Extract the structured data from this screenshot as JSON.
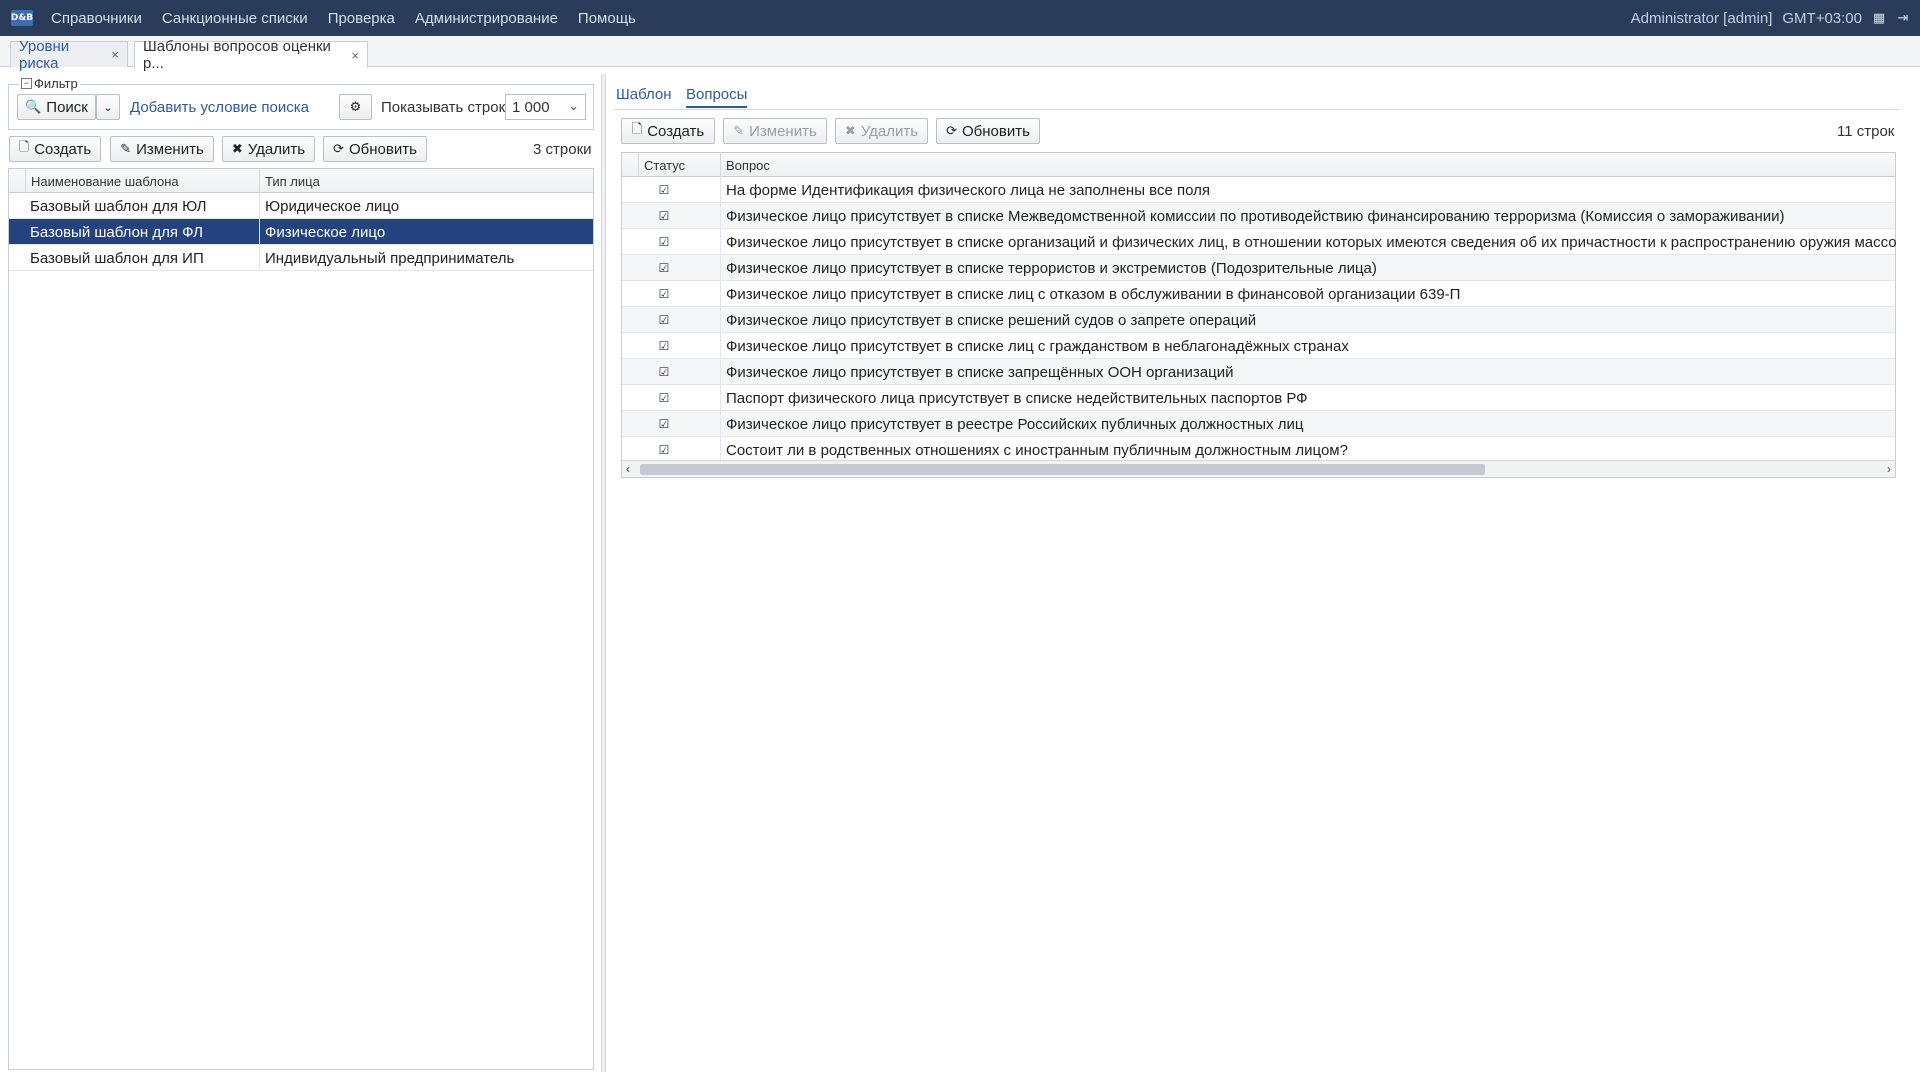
{
  "topbar": {
    "logo": "D&B",
    "menu": [
      "Справочники",
      "Санкционные списки",
      "Проверка",
      "Администрирование",
      "Помощь"
    ],
    "user": "Administrator [admin]",
    "timezone": "GMT+03:00"
  },
  "doctabs": [
    {
      "label": "Уровни риска",
      "close": "×"
    },
    {
      "label": "Шаблоны вопросов оценки р...",
      "close": "×"
    }
  ],
  "filter": {
    "legend": "Фильтр",
    "search_label": "Поиск",
    "add_condition": "Добавить условие поиска",
    "show_rows_label": "Показывать строк",
    "show_rows_value": "1 000"
  },
  "left_toolbar": {
    "create": "Создать",
    "edit": "Изменить",
    "delete": "Удалить",
    "refresh": "Обновить",
    "count": "3 строки"
  },
  "templates_table": {
    "columns": [
      "Наименование шаблона",
      "Тип лица"
    ],
    "rows": [
      {
        "name": "Базовый шаблон для ЮЛ",
        "type": "Юридическое лицо"
      },
      {
        "name": "Базовый шаблон для ФЛ",
        "type": "Физическое лицо"
      },
      {
        "name": "Базовый шаблон для ИП",
        "type": "Индивидуальный предприниматель"
      }
    ]
  },
  "right": {
    "tabs": [
      "Шаблон",
      "Вопросы"
    ],
    "toolbar": {
      "create": "Создать",
      "edit": "Изменить",
      "delete": "Удалить",
      "refresh": "Обновить",
      "count": "11 строк"
    },
    "columns": [
      "Статус",
      "Вопрос"
    ],
    "questions": [
      "На форме Идентификация физического лица не заполнены все поля",
      "Физическое лицо присутствует в списке Межведомственной комиссии по противодействию финансированию терроризма (Комиссия о замораживании)",
      "Физическое лицо присутствует в списке организаций и физических лиц, в отношении которых имеются сведения об их причастности к распространению оружия массового уничт",
      "Физическое лицо присутствует в списке террористов и экстремистов (Подозрительные лица)",
      "Физическое лицо присутствует в списке лиц с отказом в обслуживании в финансовой организации 639-П",
      "Физическое лицо присутствует в списке решений судов о запрете операций",
      "Физическое лицо присутствует в списке лиц с гражданством в неблагонадёжных странах",
      "Физическое лицо присутствует в списке запрещённых ООН организаций",
      "Паспорт физического лица присутствует в списке недействительных паспортов РФ",
      "Физическое лицо присутствует в реестре Российских публичных должностных лиц",
      "Состоит ли в родственных отношениях с иностранным публичным должностным лицом?"
    ]
  }
}
